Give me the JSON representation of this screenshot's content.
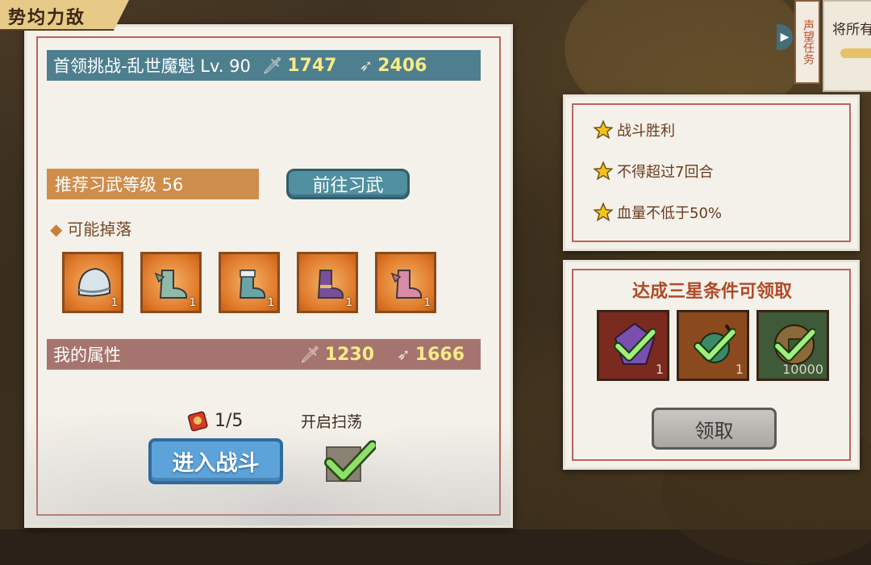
{
  "screen_title": "势均力敌",
  "boss": {
    "name": "首领挑战-乱世魔魁 Lv. 90",
    "attack": "1747",
    "defense": "2406"
  },
  "recommend": {
    "label": "推荐习武等级 56",
    "goto_button": "前往习武"
  },
  "drops": {
    "label": "可能掉落",
    "items": [
      {
        "icon": "helmet-icon",
        "count": "1"
      },
      {
        "icon": "boots-icon",
        "count": "1"
      },
      {
        "icon": "boots-icon",
        "count": "1"
      },
      {
        "icon": "boots-icon",
        "count": "1"
      },
      {
        "icon": "boots-icon",
        "count": "1"
      }
    ]
  },
  "my_stats": {
    "label": "我的属性",
    "attack": "1230",
    "defense": "1666"
  },
  "battle": {
    "tickets": "1/5",
    "sweep_label": "开启扫荡",
    "enter_button": "进入战斗",
    "sweep_checked": true
  },
  "conditions": [
    "战斗胜利",
    "不得超过7回合",
    "血量不低于50%"
  ],
  "rewards": {
    "title": "达成三星条件可领取",
    "items": [
      {
        "icon": "gem-icon",
        "count": "1",
        "bg": "#7a2a1e"
      },
      {
        "icon": "jade-pendant-icon",
        "count": "1",
        "bg": "#8a4a1e"
      },
      {
        "icon": "coin-icon",
        "count": "10000",
        "bg": "#3e5a38"
      }
    ],
    "claim_button": "领取"
  },
  "side": {
    "tab_label": "声望任务",
    "card_text": "将所有"
  }
}
